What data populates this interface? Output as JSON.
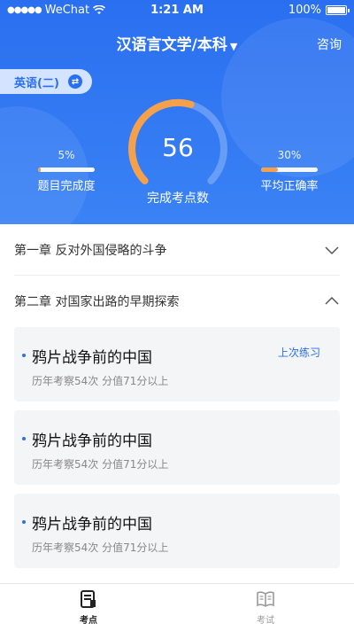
{
  "status_bar": {
    "carrier": "WeChat",
    "time": "1:21 AM",
    "battery": "100%"
  },
  "nav": {
    "title": "汉语言文学/本科",
    "consult": "咨询"
  },
  "subject": {
    "label": "英语(二)"
  },
  "gauge": {
    "value": "56",
    "label": "完成考点数",
    "progress_fraction": 0.56
  },
  "stats": {
    "completion": {
      "value": "5%",
      "label": "题目完成度",
      "fraction": 0.05
    },
    "accuracy": {
      "value": "30%",
      "label": "平均正确率",
      "fraction": 0.3
    }
  },
  "chapters": [
    {
      "title": "第一章  反对外国侵略的斗争",
      "expanded": false
    },
    {
      "title": "第二章  对国家出路的早期探索",
      "expanded": true
    }
  ],
  "cards": [
    {
      "title": "鸦片战争前的中国",
      "meta": "历年考察54次 分值71分以上",
      "tag": "上次练习"
    },
    {
      "title": "鸦片战争前的中国",
      "meta": "历年考察54次 分值71分以上",
      "tag": ""
    },
    {
      "title": "鸦片战争前的中国",
      "meta": "历年考察54次 分值71分以上",
      "tag": ""
    }
  ],
  "tabbar": {
    "tabs": [
      {
        "label": "考点",
        "icon": "document-icon",
        "active": true
      },
      {
        "label": "考试",
        "icon": "book-icon",
        "active": false
      }
    ]
  },
  "colors": {
    "primary": "#2a6ff0",
    "accent": "#f5a04a",
    "background": "#f4f5f7"
  }
}
